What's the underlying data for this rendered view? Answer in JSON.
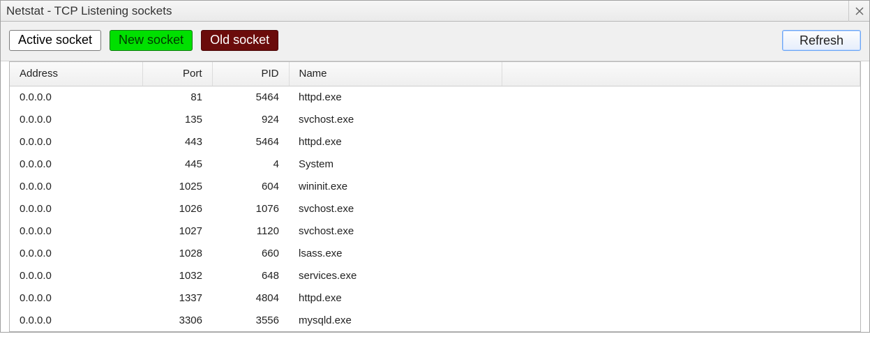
{
  "window": {
    "title": "Netstat - TCP Listening sockets"
  },
  "legend": {
    "active": "Active socket",
    "new": "New socket",
    "old": "Old socket"
  },
  "refresh_label": "Refresh",
  "columns": {
    "address": "Address",
    "port": "Port",
    "pid": "PID",
    "name": "Name"
  },
  "rows": [
    {
      "address": "0.0.0.0",
      "port": "81",
      "pid": "5464",
      "name": "httpd.exe"
    },
    {
      "address": "0.0.0.0",
      "port": "135",
      "pid": "924",
      "name": "svchost.exe"
    },
    {
      "address": "0.0.0.0",
      "port": "443",
      "pid": "5464",
      "name": "httpd.exe"
    },
    {
      "address": "0.0.0.0",
      "port": "445",
      "pid": "4",
      "name": "System"
    },
    {
      "address": "0.0.0.0",
      "port": "1025",
      "pid": "604",
      "name": "wininit.exe"
    },
    {
      "address": "0.0.0.0",
      "port": "1026",
      "pid": "1076",
      "name": "svchost.exe"
    },
    {
      "address": "0.0.0.0",
      "port": "1027",
      "pid": "1120",
      "name": "svchost.exe"
    },
    {
      "address": "0.0.0.0",
      "port": "1028",
      "pid": "660",
      "name": "lsass.exe"
    },
    {
      "address": "0.0.0.0",
      "port": "1032",
      "pid": "648",
      "name": "services.exe"
    },
    {
      "address": "0.0.0.0",
      "port": "1337",
      "pid": "4804",
      "name": "httpd.exe"
    },
    {
      "address": "0.0.0.0",
      "port": "3306",
      "pid": "3556",
      "name": "mysqld.exe"
    }
  ]
}
